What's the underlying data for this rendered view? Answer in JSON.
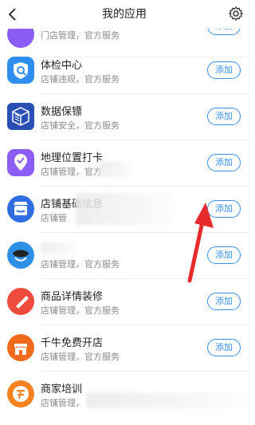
{
  "header": {
    "title": "我的应用"
  },
  "partial_row": {
    "desc": "门店管理，官方服务",
    "button": "添加"
  },
  "apps": [
    {
      "name": "体检中心",
      "desc": "店铺违规，官方服务",
      "button": "添加",
      "icon_color": "#2f8ff0"
    },
    {
      "name": "数据保镖",
      "desc": "店铺安全，官方服务",
      "button": "添加",
      "icon_color": "#2a4fb4"
    },
    {
      "name": "地理位置打卡",
      "desc": "店铺管理，官方",
      "button": "添加",
      "icon_color": "#8b5cf6"
    },
    {
      "name": "店铺基础信息",
      "desc": "店铺管",
      "button": "添加",
      "icon_color": "#2f6de0"
    },
    {
      "name": "",
      "desc": "店铺管理，官方服务",
      "button": "添加",
      "icon_color": "#2e8fe6"
    },
    {
      "name": "商品详情装修",
      "desc": "店铺管理，官方服务",
      "button": "添加",
      "icon_color": "#ef4b3c"
    },
    {
      "name": "千牛免费开店",
      "desc": "店铺管理，官方服务",
      "button": "添加",
      "icon_color": "#f26a1b"
    },
    {
      "name": "商家培训",
      "desc": "店铺管理，",
      "button": "",
      "icon_color": "#f5821f"
    }
  ],
  "colors": {
    "accent": "#3a8ee6",
    "annotation_arrow": "#e52b2b"
  }
}
